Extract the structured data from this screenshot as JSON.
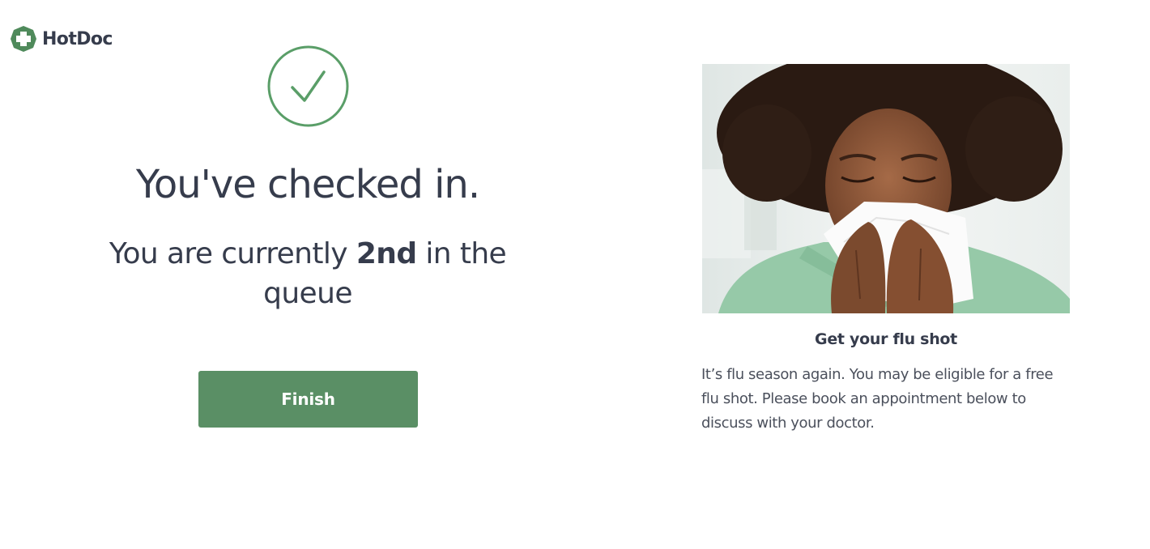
{
  "brand": {
    "name": "HotDoc",
    "logo_icon": "medical-cross-icon",
    "color": "#4f8a5b"
  },
  "checkin": {
    "status_icon": "checkmark-icon",
    "title": "You've checked in.",
    "queue_prefix": "You are currently ",
    "queue_position": "2nd",
    "queue_suffix": " in the queue",
    "finish_label": "Finish"
  },
  "promo": {
    "image_description": "woman-blowing-nose-into-tissue",
    "title": "Get your flu shot",
    "text": "It’s flu season again. You may be eligible for a free flu shot. Please book an appointment below to discuss with your doctor."
  },
  "colors": {
    "accent": "#5a8f65",
    "check": "#5a9e68",
    "text": "#363c4c",
    "body_text": "#4b505c",
    "background": "#ffffff"
  }
}
